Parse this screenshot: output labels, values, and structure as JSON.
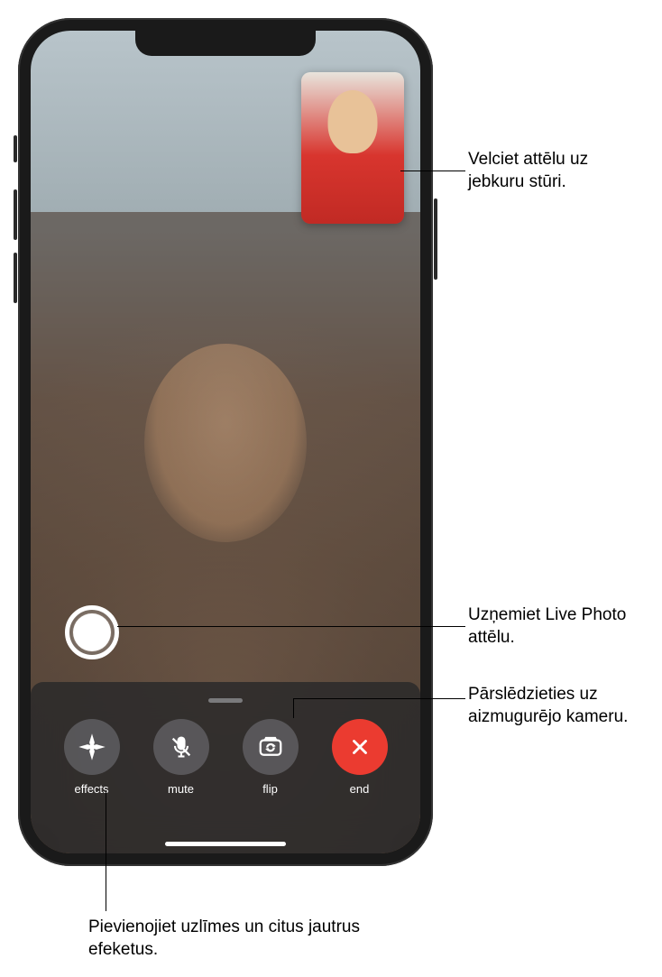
{
  "controls": {
    "effects": {
      "label": "effects",
      "icon": "effects-icon"
    },
    "mute": {
      "label": "mute",
      "icon": "mute-icon"
    },
    "flip": {
      "label": "flip",
      "icon": "flip-icon"
    },
    "end": {
      "label": "end",
      "icon": "end-icon"
    }
  },
  "callouts": {
    "pip": "Velciet attēlu uz jebkuru stūri.",
    "shutter": "Uzņemiet Live Photo attēlu.",
    "flip": "Pārslēdzieties uz aizmugurējo kameru.",
    "effects": "Pievienojiet uzlīmes un citus jautrus efeketus."
  }
}
